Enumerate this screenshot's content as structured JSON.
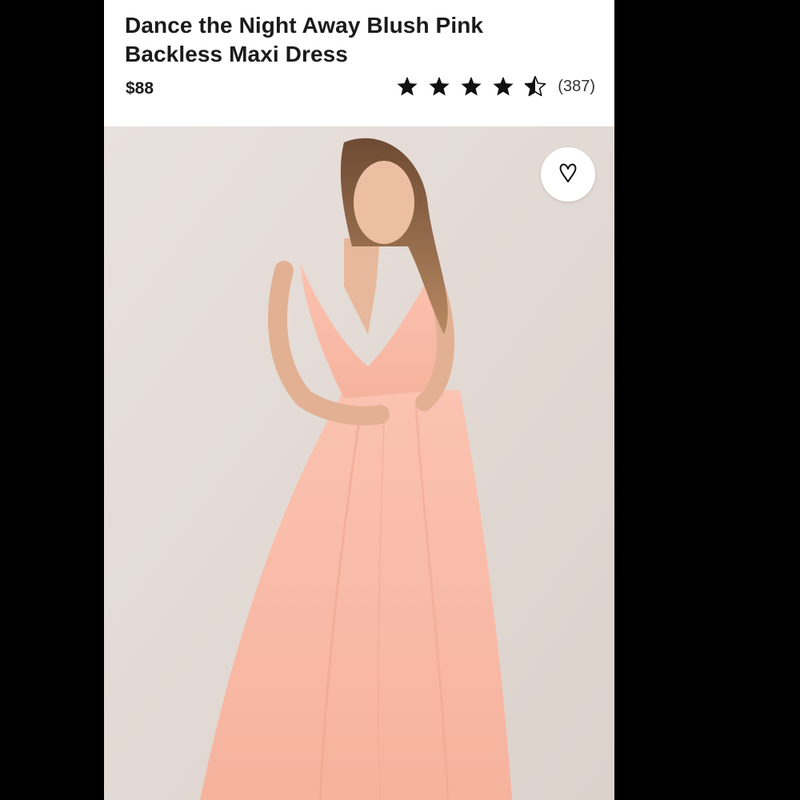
{
  "product": {
    "title": "Dance the Night Away Blush Pink Backless Maxi Dress",
    "price": "$88",
    "rating": {
      "stars": 4.5,
      "max": 5,
      "count": "(387)"
    }
  },
  "image": {
    "description_icon": "heart-icon"
  },
  "colors": {
    "background": "#000000",
    "card": "#ffffff",
    "text": "#1b1b1b",
    "dress": "#f7b7a3",
    "backdrop": "#e5ddd8"
  }
}
